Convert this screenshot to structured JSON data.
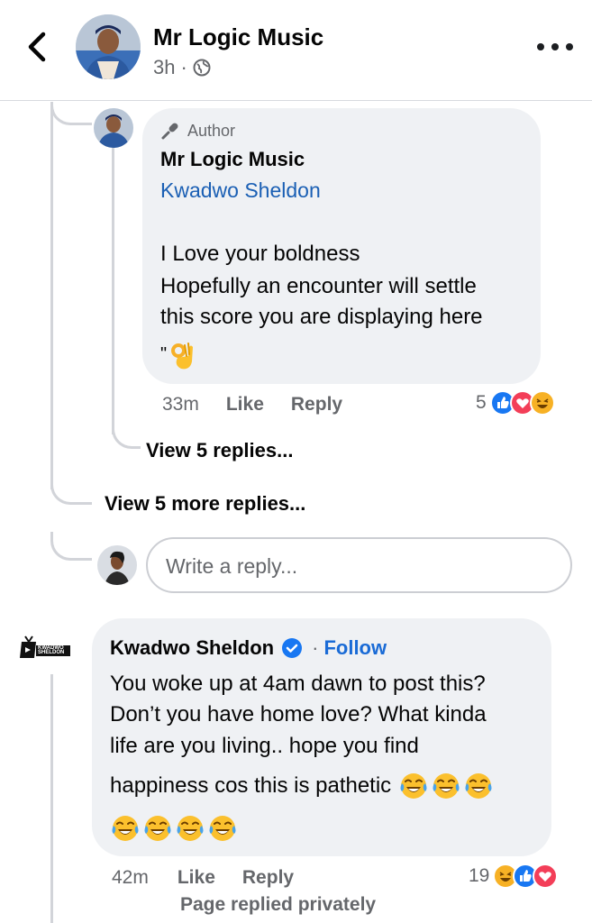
{
  "header": {
    "back_icon": "back-chevron-icon",
    "page_name": "Mr Logic Music",
    "time": "3h",
    "separator": "·",
    "privacy_icon": "globe-icon",
    "more_icon": "more-horizontal-icon"
  },
  "reply_comment": {
    "author_tag": "Author",
    "author_tag_icon": "microphone-icon",
    "name": "Mr Logic Music",
    "mention": "Kwadwo Sheldon",
    "lines": [
      "I Love your boldness",
      "Hopefully an encounter will settle",
      "this score you are displaying here",
      "\""
    ],
    "emoji": "ok-hand-emoji",
    "time": "33m",
    "like": "Like",
    "reply": "Reply",
    "reaction_count": "5",
    "reactions": [
      "like",
      "love",
      "haha"
    ]
  },
  "view_replies": "View 5 replies...",
  "view_more_replies": "View 5 more replies...",
  "reply_input": {
    "placeholder": "Write a reply..."
  },
  "comment": {
    "name": "Kwadwo Sheldon",
    "verified_icon": "verified-badge-icon",
    "separator": "·",
    "follow": "Follow",
    "avatar_logo_text": "KWADWO SHELDON",
    "lines": [
      "You woke up at 4am dawn to post this?",
      "Don’t you have home love? What kinda",
      "life are you living.. hope you find",
      "happiness cos this is pathetic"
    ],
    "emojis_inline": 3,
    "emojis_line": 4,
    "time": "42m",
    "like": "Like",
    "reply": "Reply",
    "reaction_count": "19",
    "reactions": [
      "haha",
      "like",
      "love"
    ],
    "note": "Page replied privately"
  },
  "colors": {
    "bubble": "#eff1f4",
    "like_blue": "#1877f2",
    "love_red": "#f33e58",
    "haha_yellow": "#f7b125",
    "link_blue": "#1a5fb4"
  }
}
